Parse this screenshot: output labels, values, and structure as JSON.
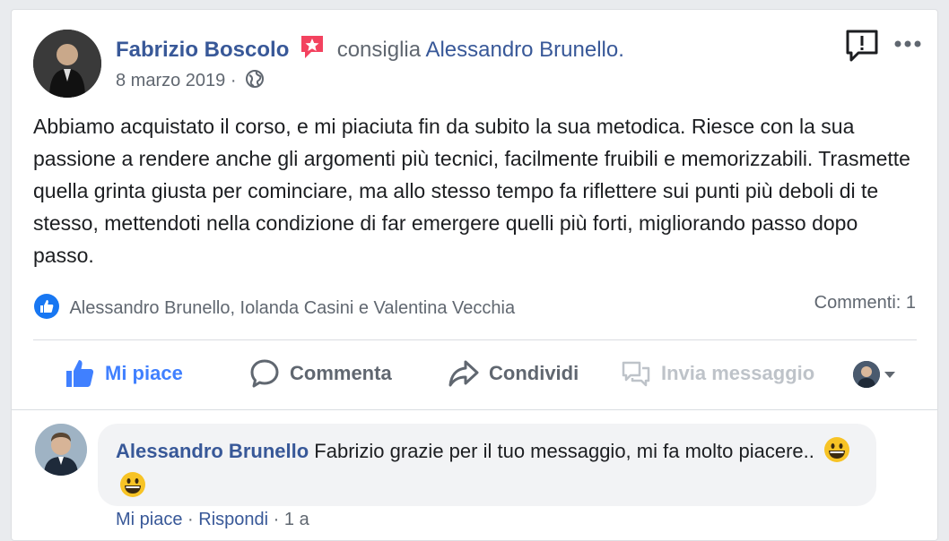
{
  "post": {
    "author": "Fabrizio Boscolo",
    "verb": "consiglia",
    "target": "Alessandro Brunello.",
    "date": "8 marzo 2019",
    "date_sep": "·",
    "body": "Abbiamo acquistato il corso, e mi piaciuta fin da subito la sua metodica. Riesce con la sua passione a rendere anche gli argomenti più tecnici, facilmente fruibili e memorizzabili. Trasmette quella grinta giusta per cominciare, ma allo stesso tempo fa riflettere sui punti più deboli di te stesso, mettendoti nella condizione di far emergere quelli più forti, migliorando passo dopo passo.",
    "reactions_text": "Alessandro Brunello, Iolanda Casini e Valentina Vecchia",
    "comments_count": "Commenti: 1"
  },
  "actions": {
    "like": "Mi piace",
    "comment": "Commenta",
    "share": "Condividi",
    "message": "Invia messaggio"
  },
  "comment": {
    "author": "Alessandro Brunello",
    "text": "Fabrizio grazie per il tuo messaggio, mi fa molto piacere..",
    "like": "Mi piace",
    "reply": "Rispondi",
    "sep": "·",
    "time": "1 a"
  },
  "colors": {
    "link_blue": "#385898",
    "like_blue": "#4080ff",
    "muted": "#606770",
    "recommend_badge": "#f3425f"
  },
  "icons": [
    "recommend-star-icon",
    "globe-icon",
    "report-icon",
    "more-icon",
    "thumbs-up-icon",
    "comment-icon",
    "share-icon",
    "message-icon",
    "chevron-down-icon",
    "grinning-emoji-icon"
  ]
}
